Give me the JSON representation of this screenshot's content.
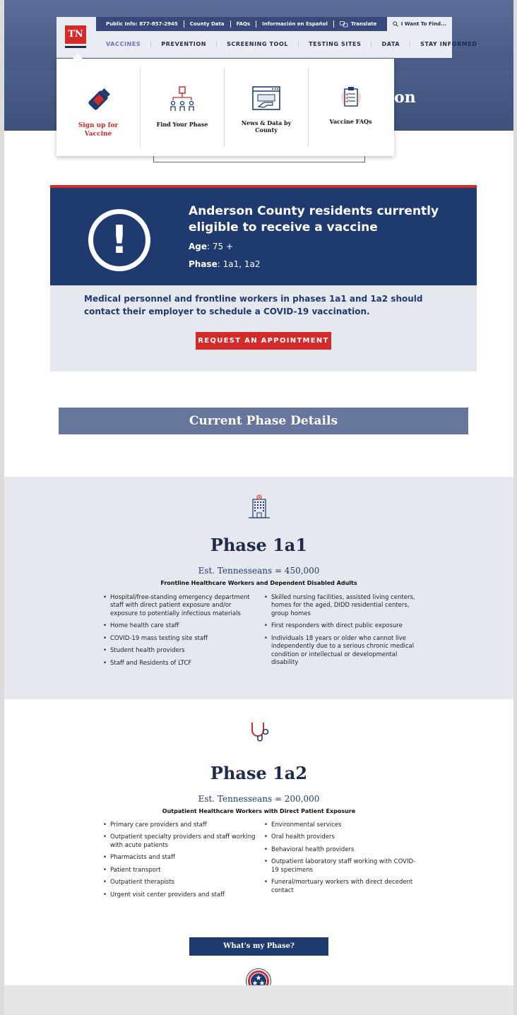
{
  "header": {
    "logo_text": "TN",
    "topbar": {
      "public_info": "Public Info: 877-857-2945",
      "county_data": "County Data",
      "faqs": "FAQs",
      "espanol": "Información en Español",
      "translate": "Translate",
      "search": "I Want To Find..."
    },
    "menu": [
      "VACCINES",
      "PREVENTION",
      "SCREENING TOOL",
      "TESTING SITES",
      "DATA",
      "STAY INFORMED"
    ],
    "hero_title_fragment": "on"
  },
  "dropdown": [
    {
      "label": "Sign up for Vaccine",
      "icon": "vaccine-vial-icon"
    },
    {
      "label": "Find Your Phase",
      "icon": "people-hierarchy-icon"
    },
    {
      "label": "News & Data by County",
      "icon": "browser-hand-icon"
    },
    {
      "label": "Vaccine FAQs",
      "icon": "clipboard-checklist-icon"
    }
  ],
  "alert": {
    "heading": "Anderson County residents currently eligible to receive a vaccine",
    "age_label": "Age",
    "age_value": ": 75 +",
    "phase_label": "Phase",
    "phase_value": ": 1a1, 1a2",
    "message": "Medical personnel and frontline workers in phases 1a1 and 1a2  should contact their employer to schedule a  COVID-19 vaccination.",
    "button": "REQUEST AN APPOINTMENT"
  },
  "current_phase_details": "Current Phase Details",
  "phase1": {
    "title": "Phase 1a1",
    "est": "Est. Tennesseans = 450,000",
    "subtitle": "Frontline Healthcare Workers and Dependent Disabled Adults",
    "left": [
      "Hospital/free-standing emergency department staff with direct patient exposure and/or exposure to potentially infectious materials",
      "Home health care staff",
      "COVID-19 mass testing site staff",
      "Student health providers",
      "Staff and Residents of LTCF"
    ],
    "right": [
      "Skilled nursing facilities, assisted living centers, homes for the aged, DIDD residential centers, group homes",
      "First responders with direct public exposure",
      "Individuals 18 years or older who cannot live independently due to a serious chronic medical condition or intellectual or developmental disability"
    ]
  },
  "phase2": {
    "title": "Phase 1a2",
    "est": "Est. Tennesseans = 200,000",
    "subtitle": "Outpatient Healthcare Workers with Direct Patient Exposure",
    "left": [
      "Primary care providers and staff",
      "Outpatient specialty providers and staff working with acute patients",
      "Pharmacists and staff",
      "Patient transport",
      "Outpatient therapists",
      "Urgent visit center providers and staff"
    ],
    "right": [
      "Environmental services",
      "Oral health providers",
      "Behavioral health providers",
      "Outpatient laboratory staff working with COVID-19 specimens",
      "Funeral/mortuary workers with direct decedent contact"
    ],
    "button": "What's my Phase?"
  },
  "colors": {
    "navy": "#1f3a6e",
    "red": "#d42a2a",
    "slate": "#66769c",
    "light": "#e5e8ef"
  }
}
